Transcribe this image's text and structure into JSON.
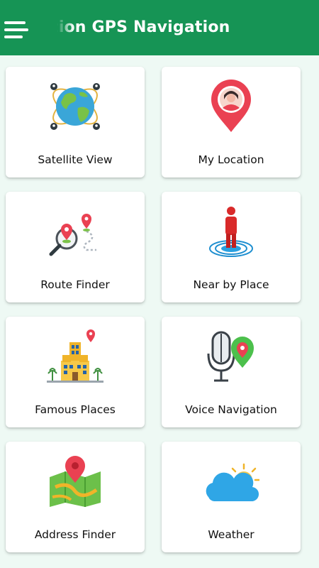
{
  "app_bar": {
    "title": "tion GPS Navigation",
    "menu_icon": "hamburger-menu-icon",
    "color": "#169455"
  },
  "grid": {
    "items": [
      {
        "label": "Satellite View",
        "icon": "globe-satellite-icon"
      },
      {
        "label": "My Location",
        "icon": "location-pin-person-icon"
      },
      {
        "label": "Route Finder",
        "icon": "route-magnifier-icon"
      },
      {
        "label": "Near by Place",
        "icon": "person-radar-icon"
      },
      {
        "label": "Famous Places",
        "icon": "building-landmark-icon"
      },
      {
        "label": "Voice Navigation",
        "icon": "microphone-pin-icon"
      },
      {
        "label": "Address Finder",
        "icon": "map-pin-icon"
      },
      {
        "label": "Weather",
        "icon": "sun-cloud-icon"
      }
    ]
  }
}
